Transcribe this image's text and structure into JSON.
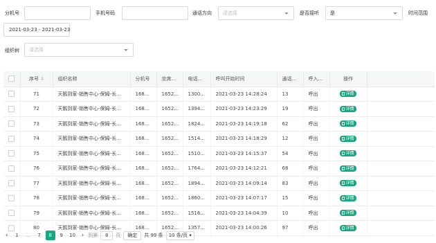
{
  "filters": {
    "ext_label": "分机号",
    "phone_label": "手机号码",
    "direction_label": "通话方向",
    "direction_placeholder": "请选择",
    "answered_label": "是否接听",
    "answered_value": "是",
    "time_label": "时间范围",
    "date_range": "2021-03-23 - 2021-03-23",
    "org_label": "组织树",
    "org_placeholder": "请选择"
  },
  "table": {
    "headers": [
      "序号",
      "组织名称",
      "分机号",
      "坐席...",
      "电话...",
      "呼叫开始时间",
      "通话...",
      "呼入...",
      "操作"
    ],
    "action_label": "详情",
    "rows": [
      {
        "no": "71",
        "org": "天鹅到家-销售中心-保姆-长...",
        "ext": "168...",
        "seat": "1652...",
        "phone": "1300...",
        "start": "2021-03-23 14:28:24",
        "dur": "13",
        "dir": "呼出"
      },
      {
        "no": "72",
        "org": "天鹅到家-销售中心-保姆-长...",
        "ext": "168...",
        "seat": "1652...",
        "phone": "1394...",
        "start": "2021-03-23 14:23:29",
        "dur": "19",
        "dir": "呼出"
      },
      {
        "no": "73",
        "org": "天鹅到家-销售中心-保姆-长...",
        "ext": "168...",
        "seat": "1652...",
        "phone": "1824...",
        "start": "2021-03-23 14:19:18",
        "dur": "62",
        "dir": "呼出"
      },
      {
        "no": "74",
        "org": "天鹅到家-销售中心-保姆-长...",
        "ext": "168...",
        "seat": "1652...",
        "phone": "1514...",
        "start": "2021-03-23 14:18:29",
        "dur": "12",
        "dir": "呼出"
      },
      {
        "no": "75",
        "org": "天鹅到家-销售中心-保姆-长...",
        "ext": "168...",
        "seat": "1652...",
        "phone": "1510...",
        "start": "2021-03-23 14:15:37",
        "dur": "54",
        "dir": "呼出"
      },
      {
        "no": "76",
        "org": "天鹅到家-销售中心-保姆-长...",
        "ext": "168...",
        "seat": "1652...",
        "phone": "1764...",
        "start": "2021-03-23 14:12:21",
        "dur": "68",
        "dir": "呼出"
      },
      {
        "no": "77",
        "org": "天鹅到家-销售中心-保姆-长...",
        "ext": "168...",
        "seat": "1652...",
        "phone": "1894...",
        "start": "2021-03-23 14:09:14",
        "dur": "83",
        "dir": "呼出"
      },
      {
        "no": "78",
        "org": "天鹅到家-销售中心-保姆-长...",
        "ext": "168...",
        "seat": "1652...",
        "phone": "1860...",
        "start": "2021-03-23 14:07:17",
        "dur": "15",
        "dir": "呼出"
      },
      {
        "no": "79",
        "org": "天鹅到家-销售中心-保姆-长...",
        "ext": "168...",
        "seat": "1652...",
        "phone": "1516...",
        "start": "2021-03-23 14:04:39",
        "dur": "10",
        "dir": "呼出"
      },
      {
        "no": "80",
        "org": "天鹅到家-销售中心-保姆-长...",
        "ext": "168...",
        "seat": "1652...",
        "phone": "1357...",
        "start": "2021-03-23 14:00:26",
        "dur": "97",
        "dir": "呼出"
      }
    ]
  },
  "pagination": {
    "prev": "‹",
    "first": "1",
    "ellipsis": "...",
    "pages": [
      "7",
      "8",
      "9",
      "10"
    ],
    "current": "8",
    "next": "›",
    "goto_label": "到第",
    "goto_value": "8",
    "page_unit": "页",
    "confirm": "确定",
    "total": "共 99 条",
    "page_size": "10 条/页"
  },
  "colors": {
    "accent": "#17a882",
    "header_bg": "#f5f6f8"
  },
  "icons": [
    "chevron-down-icon",
    "sort-icon",
    "document-icon",
    "chevron-left-icon",
    "chevron-right-icon"
  ]
}
